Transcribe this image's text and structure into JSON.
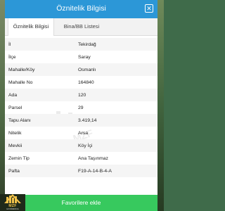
{
  "header": {
    "title": "Öznitelik Bilgisi",
    "close_icon": "close-icon"
  },
  "tabs": [
    {
      "label": "Öznitelik Bilgisi",
      "active": true
    },
    {
      "label": "Bina/BB Listesi",
      "active": false
    }
  ],
  "rows": [
    {
      "key": "İl",
      "value": "Tekirdağ"
    },
    {
      "key": "İlçe",
      "value": "Saray"
    },
    {
      "key": "Mahalle/Köy",
      "value": "Osmanlı"
    },
    {
      "key": "Mahalle No",
      "value": "164840"
    },
    {
      "key": "Ada",
      "value": "120"
    },
    {
      "key": "Parsel",
      "value": "29"
    },
    {
      "key": "Tapu Alanı",
      "value": "3.419,14"
    },
    {
      "key": "Nitelik",
      "value": "Arsa"
    },
    {
      "key": "Mevkii",
      "value": "Köy İçi"
    },
    {
      "key": "Zemin Tip",
      "value": "Ana Taşınmaz"
    },
    {
      "key": "Pafta",
      "value": "F19-A-14-B-4-A"
    }
  ],
  "footer": {
    "favorite_label": "Favorilere ekle"
  },
  "logo": {
    "name": "MZF",
    "subtitle": "GAYRİMENKUL"
  },
  "colors": {
    "header": "#2c97d7",
    "button": "#37c95e"
  }
}
